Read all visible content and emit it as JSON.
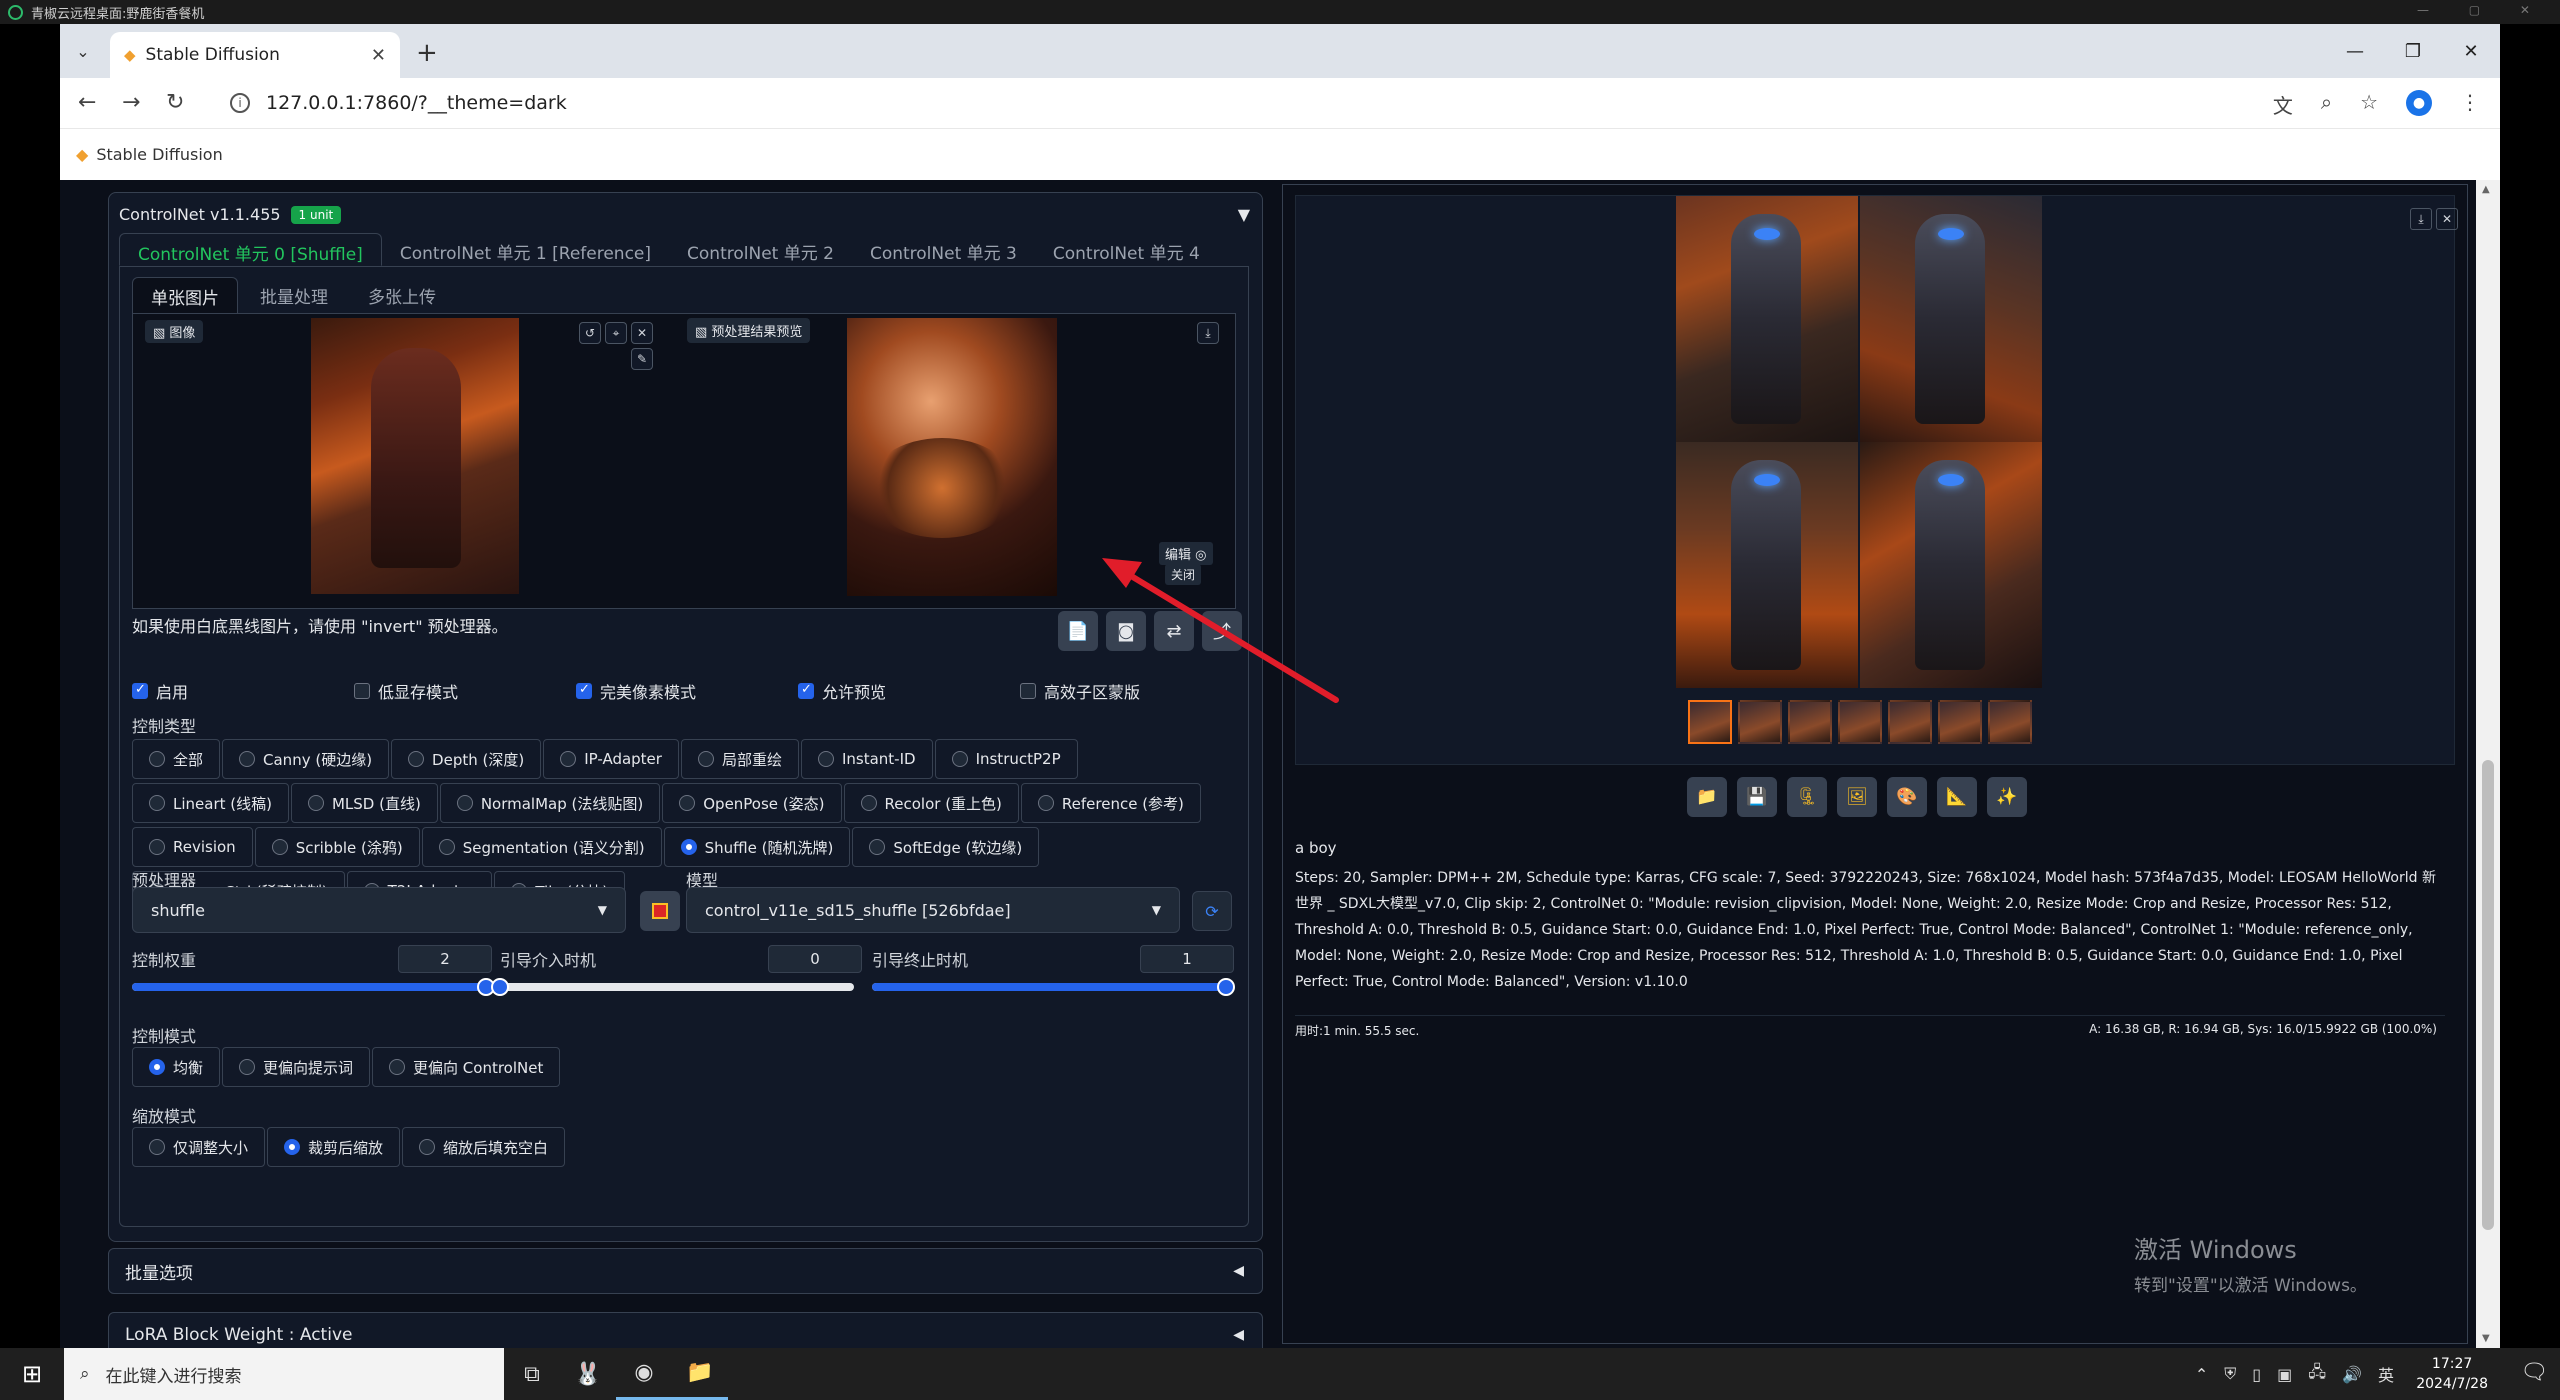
{
  "remote_title": "青椒云远程桌面:野鹿街香餐机",
  "browser": {
    "tab_title": "Stable Diffusion",
    "url": "127.0.0.1:7860/?__theme=dark",
    "bookmark": "Stable Diffusion"
  },
  "controlnet": {
    "title": "ControlNet v1.1.455",
    "badge": "1 unit",
    "unit_tabs": [
      "ControlNet 单元 0 [Shuffle]",
      "ControlNet 单元 1 [Reference]",
      "ControlNet 单元 2",
      "ControlNet 单元 3",
      "ControlNet 单元 4"
    ],
    "sub_tabs": [
      "单张图片",
      "批量处理",
      "多张上传"
    ],
    "image_label": "图像",
    "preview_label": "预处理结果预览",
    "edit_label": "编辑",
    "close_label": "关闭",
    "hint": "如果使用白底黑线图片，请使用 \"invert\" 预处理器。",
    "checkboxes": [
      {
        "label": "启用",
        "checked": true
      },
      {
        "label": "低显存模式",
        "checked": false
      },
      {
        "label": "完美像素模式",
        "checked": true
      },
      {
        "label": "允许预览",
        "checked": true
      },
      {
        "label": "高效子区蒙版",
        "checked": false
      }
    ],
    "control_type_label": "控制类型",
    "control_types": [
      {
        "label": "全部",
        "selected": false
      },
      {
        "label": "Canny (硬边缘)",
        "selected": false
      },
      {
        "label": "Depth (深度)",
        "selected": false
      },
      {
        "label": "IP-Adapter",
        "selected": false
      },
      {
        "label": "局部重绘",
        "selected": false
      },
      {
        "label": "Instant-ID",
        "selected": false
      },
      {
        "label": "InstructP2P",
        "selected": false
      },
      {
        "label": "Lineart (线稿)",
        "selected": false
      },
      {
        "label": "MLSD (直线)",
        "selected": false
      },
      {
        "label": "NormalMap (法线贴图)",
        "selected": false
      },
      {
        "label": "OpenPose (姿态)",
        "selected": false
      },
      {
        "label": "Recolor (重上色)",
        "selected": false
      },
      {
        "label": "Reference (参考)",
        "selected": false
      },
      {
        "label": "Revision",
        "selected": false
      },
      {
        "label": "Scribble (涂鸦)",
        "selected": false
      },
      {
        "label": "Segmentation (语义分割)",
        "selected": false
      },
      {
        "label": "Shuffle (随机洗牌)",
        "selected": true
      },
      {
        "label": "SoftEdge (软边缘)",
        "selected": false
      },
      {
        "label": "SparseCtrl (稀疏控制)",
        "selected": false
      },
      {
        "label": "T2I-Adapter",
        "selected": false
      },
      {
        "label": "Tile (分块)",
        "selected": false
      }
    ],
    "preprocessor_label": "预处理器",
    "preprocessor_value": "shuffle",
    "model_label": "模型",
    "model_value": "control_v11e_sd15_shuffle [526bfdae]",
    "weight_label": "控制权重",
    "weight_value": "2",
    "weight_fraction": 1.0,
    "start_label": "引导介入时机",
    "start_value": "0",
    "start_fraction": 0.0,
    "end_label": "引导终止时机",
    "end_value": "1",
    "end_fraction": 1.0,
    "mode_label": "控制模式",
    "modes": [
      {
        "label": "均衡",
        "selected": true
      },
      {
        "label": "更偏向提示词",
        "selected": false
      },
      {
        "label": "更偏向 ControlNet",
        "selected": false
      }
    ],
    "resize_label": "缩放模式",
    "resize_modes": [
      {
        "label": "仅调整大小",
        "selected": false
      },
      {
        "label": "裁剪后缩放",
        "selected": true
      },
      {
        "label": "缩放后填充空白",
        "selected": false
      }
    ],
    "batch_options": "批量选项",
    "lora_block": "LoRA Block Weight : Active"
  },
  "output": {
    "prompt": "a boy",
    "params": "Steps: 20, Sampler: DPM++ 2M, Schedule type: Karras, CFG scale: 7, Seed: 3792220243, Size: 768x1024, Model hash: 573f4a7d35, Model: LEOSAM HelloWorld 新世界 _ SDXL大模型_v7.0, Clip skip: 2, ControlNet 0: \"Module: revision_clipvision, Model: None, Weight: 2.0, Resize Mode: Crop and Resize, Processor Res: 512, Threshold A: 0.0, Threshold B: 0.5, Guidance Start: 0.0, Guidance End: 1.0, Pixel Perfect: True, Control Mode: Balanced\", ControlNet 1: \"Module: reference_only, Model: None, Weight: 2.0, Resize Mode: Crop and Resize, Processor Res: 512, Threshold A: 1.0, Threshold B: 0.5, Guidance Start: 0.0, Guidance End: 1.0, Pixel Perfect: True, Control Mode: Balanced\", Version: v1.10.0",
    "time": "用时:1 min. 55.5 sec.",
    "vram": "A: 16.38 GB, R: 16.94 GB, Sys: 16.0/15.9922 GB (100.0%)"
  },
  "watermark": {
    "line1": "激活 Windows",
    "line2": "转到\"设置\"以激活 Windows。"
  },
  "taskbar": {
    "search_placeholder": "在此键入进行搜索",
    "ime": "英",
    "time": "17:27",
    "date": "2024/7/28"
  },
  "colors": {
    "accent": "#2563eb",
    "unit_tab_active": "#22c55e",
    "badge": "#16a34a"
  }
}
